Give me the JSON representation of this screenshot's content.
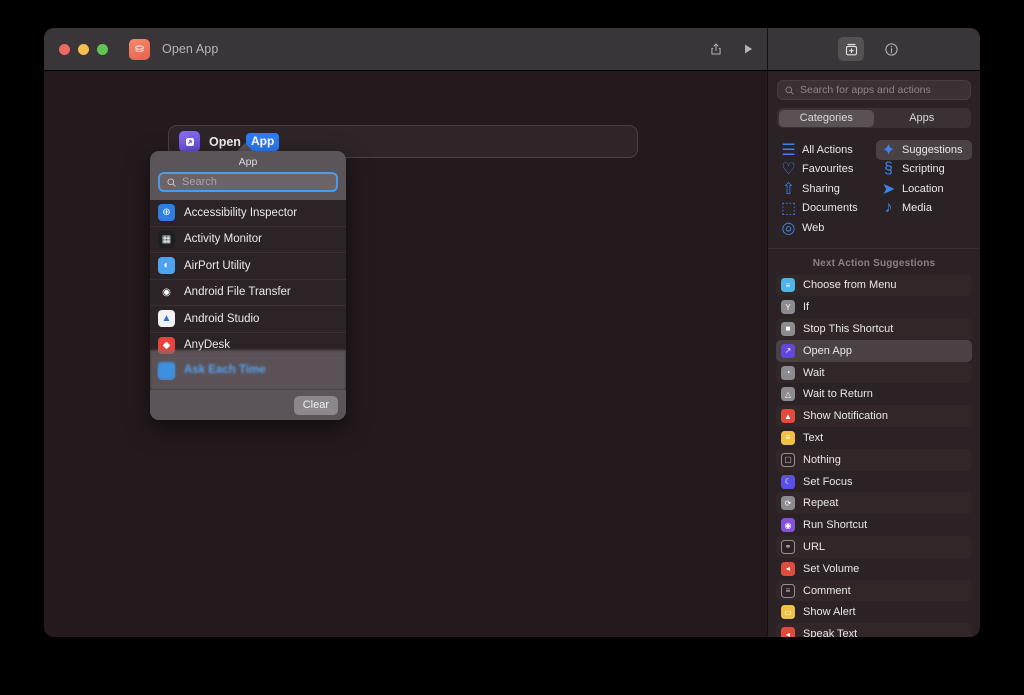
{
  "window": {
    "title": "Open App",
    "app_icon": "shortcuts-icon",
    "traffic_lights": [
      "close",
      "minimize",
      "zoom"
    ]
  },
  "toolbar": {
    "share_label": "share-icon",
    "run_label": "play-icon",
    "library_label": "action-library-icon",
    "info_label": "info-icon"
  },
  "canvas": {
    "action": {
      "icon": "open-app-icon",
      "verb": "Open",
      "token": "App"
    }
  },
  "popover": {
    "title": "App",
    "search_placeholder": "Search",
    "search_value": "",
    "clear_label": "Clear",
    "faded_item": "Ask Each Time",
    "apps": [
      {
        "label": "Accessibility Inspector",
        "icon": "accessibility-inspector-icon",
        "color": "#2f7fe0",
        "glyph": "⊕"
      },
      {
        "label": "Activity Monitor",
        "icon": "activity-monitor-icon",
        "color": "#1d1f24",
        "glyph": "▦"
      },
      {
        "label": "AirPort Utility",
        "icon": "airport-utility-icon",
        "color": "#4da3ef",
        "glyph": "◐"
      },
      {
        "label": "Android File Transfer",
        "icon": "android-file-transfer-icon",
        "color": "#2c2326",
        "glyph": "◉"
      },
      {
        "label": "Android Studio",
        "icon": "android-studio-icon",
        "color": "#f2f2f4",
        "glyph": "▲"
      },
      {
        "label": "AnyDesk",
        "icon": "anydesk-icon",
        "color": "#e8433b",
        "glyph": "◆"
      }
    ]
  },
  "sidebar": {
    "search_placeholder": "Search for apps and actions",
    "search_value": "",
    "tabs": [
      {
        "label": "Categories",
        "selected": true
      },
      {
        "label": "Apps",
        "selected": false
      }
    ],
    "categories": [
      {
        "label": "All Actions",
        "icon": "list-icon",
        "glyph": "☰",
        "selected": false
      },
      {
        "label": "Suggestions",
        "icon": "sparkle-icon",
        "glyph": "✦",
        "selected": true
      },
      {
        "label": "Favourites",
        "icon": "heart-icon",
        "glyph": "♡",
        "selected": false
      },
      {
        "label": "Scripting",
        "icon": "scripting-icon",
        "glyph": "§",
        "selected": false
      },
      {
        "label": "Sharing",
        "icon": "share-icon",
        "glyph": "⇧",
        "selected": false
      },
      {
        "label": "Location",
        "icon": "location-icon",
        "glyph": "➤",
        "selected": false
      },
      {
        "label": "Documents",
        "icon": "document-icon",
        "glyph": "⬚",
        "selected": false
      },
      {
        "label": "Media",
        "icon": "music-note-icon",
        "glyph": "♪",
        "selected": false
      },
      {
        "label": "Web",
        "icon": "compass-icon",
        "glyph": "◎",
        "selected": false
      }
    ],
    "section_title": "Next Action Suggestions",
    "actions": [
      {
        "label": "Choose from Menu",
        "icon": "choose-from-menu-icon",
        "color": "#4fb4e8",
        "glyph": "≡",
        "selected": false
      },
      {
        "label": "If",
        "icon": "if-icon",
        "color": "#8b8b90",
        "glyph": "Y",
        "selected": false
      },
      {
        "label": "Stop This Shortcut",
        "icon": "stop-shortcut-icon",
        "color": "#8b8b90",
        "glyph": "■",
        "selected": false
      },
      {
        "label": "Open App",
        "icon": "open-app-icon",
        "color": "#6247d8",
        "glyph": "↗",
        "selected": true
      },
      {
        "label": "Wait",
        "icon": "wait-icon",
        "color": "#8b8b90",
        "glyph": "◔",
        "selected": false
      },
      {
        "label": "Wait to Return",
        "icon": "wait-to-return-icon",
        "color": "#8b8b90",
        "glyph": "△",
        "selected": false
      },
      {
        "label": "Show Notification",
        "icon": "show-notification-icon",
        "color": "#e24b3c",
        "glyph": "▲",
        "selected": false
      },
      {
        "label": "Text",
        "icon": "text-icon",
        "color": "#f0c044",
        "glyph": "≡",
        "selected": false
      },
      {
        "label": "Nothing",
        "icon": "nothing-icon",
        "color": "#2b2225",
        "glyph": "▢",
        "selected": false
      },
      {
        "label": "Set Focus",
        "icon": "set-focus-icon",
        "color": "#5a4fe8",
        "glyph": "☾",
        "selected": false
      },
      {
        "label": "Repeat",
        "icon": "repeat-icon",
        "color": "#8b8b90",
        "glyph": "⟳",
        "selected": false
      },
      {
        "label": "Run Shortcut",
        "icon": "run-shortcut-icon",
        "color": "#8452d8",
        "glyph": "◉",
        "selected": false
      },
      {
        "label": "URL",
        "icon": "url-icon",
        "color": "#2b2225",
        "glyph": "⚭",
        "selected": false
      },
      {
        "label": "Set Volume",
        "icon": "set-volume-icon",
        "color": "#e24b3c",
        "glyph": "◂",
        "selected": false
      },
      {
        "label": "Comment",
        "icon": "comment-icon",
        "color": "#2b2225",
        "glyph": "≡",
        "selected": false
      },
      {
        "label": "Show Alert",
        "icon": "show-alert-icon",
        "color": "#f0c044",
        "glyph": "▭",
        "selected": false
      },
      {
        "label": "Speak Text",
        "icon": "speak-text-icon",
        "color": "#e24b3c",
        "glyph": "◂",
        "selected": false
      }
    ]
  }
}
